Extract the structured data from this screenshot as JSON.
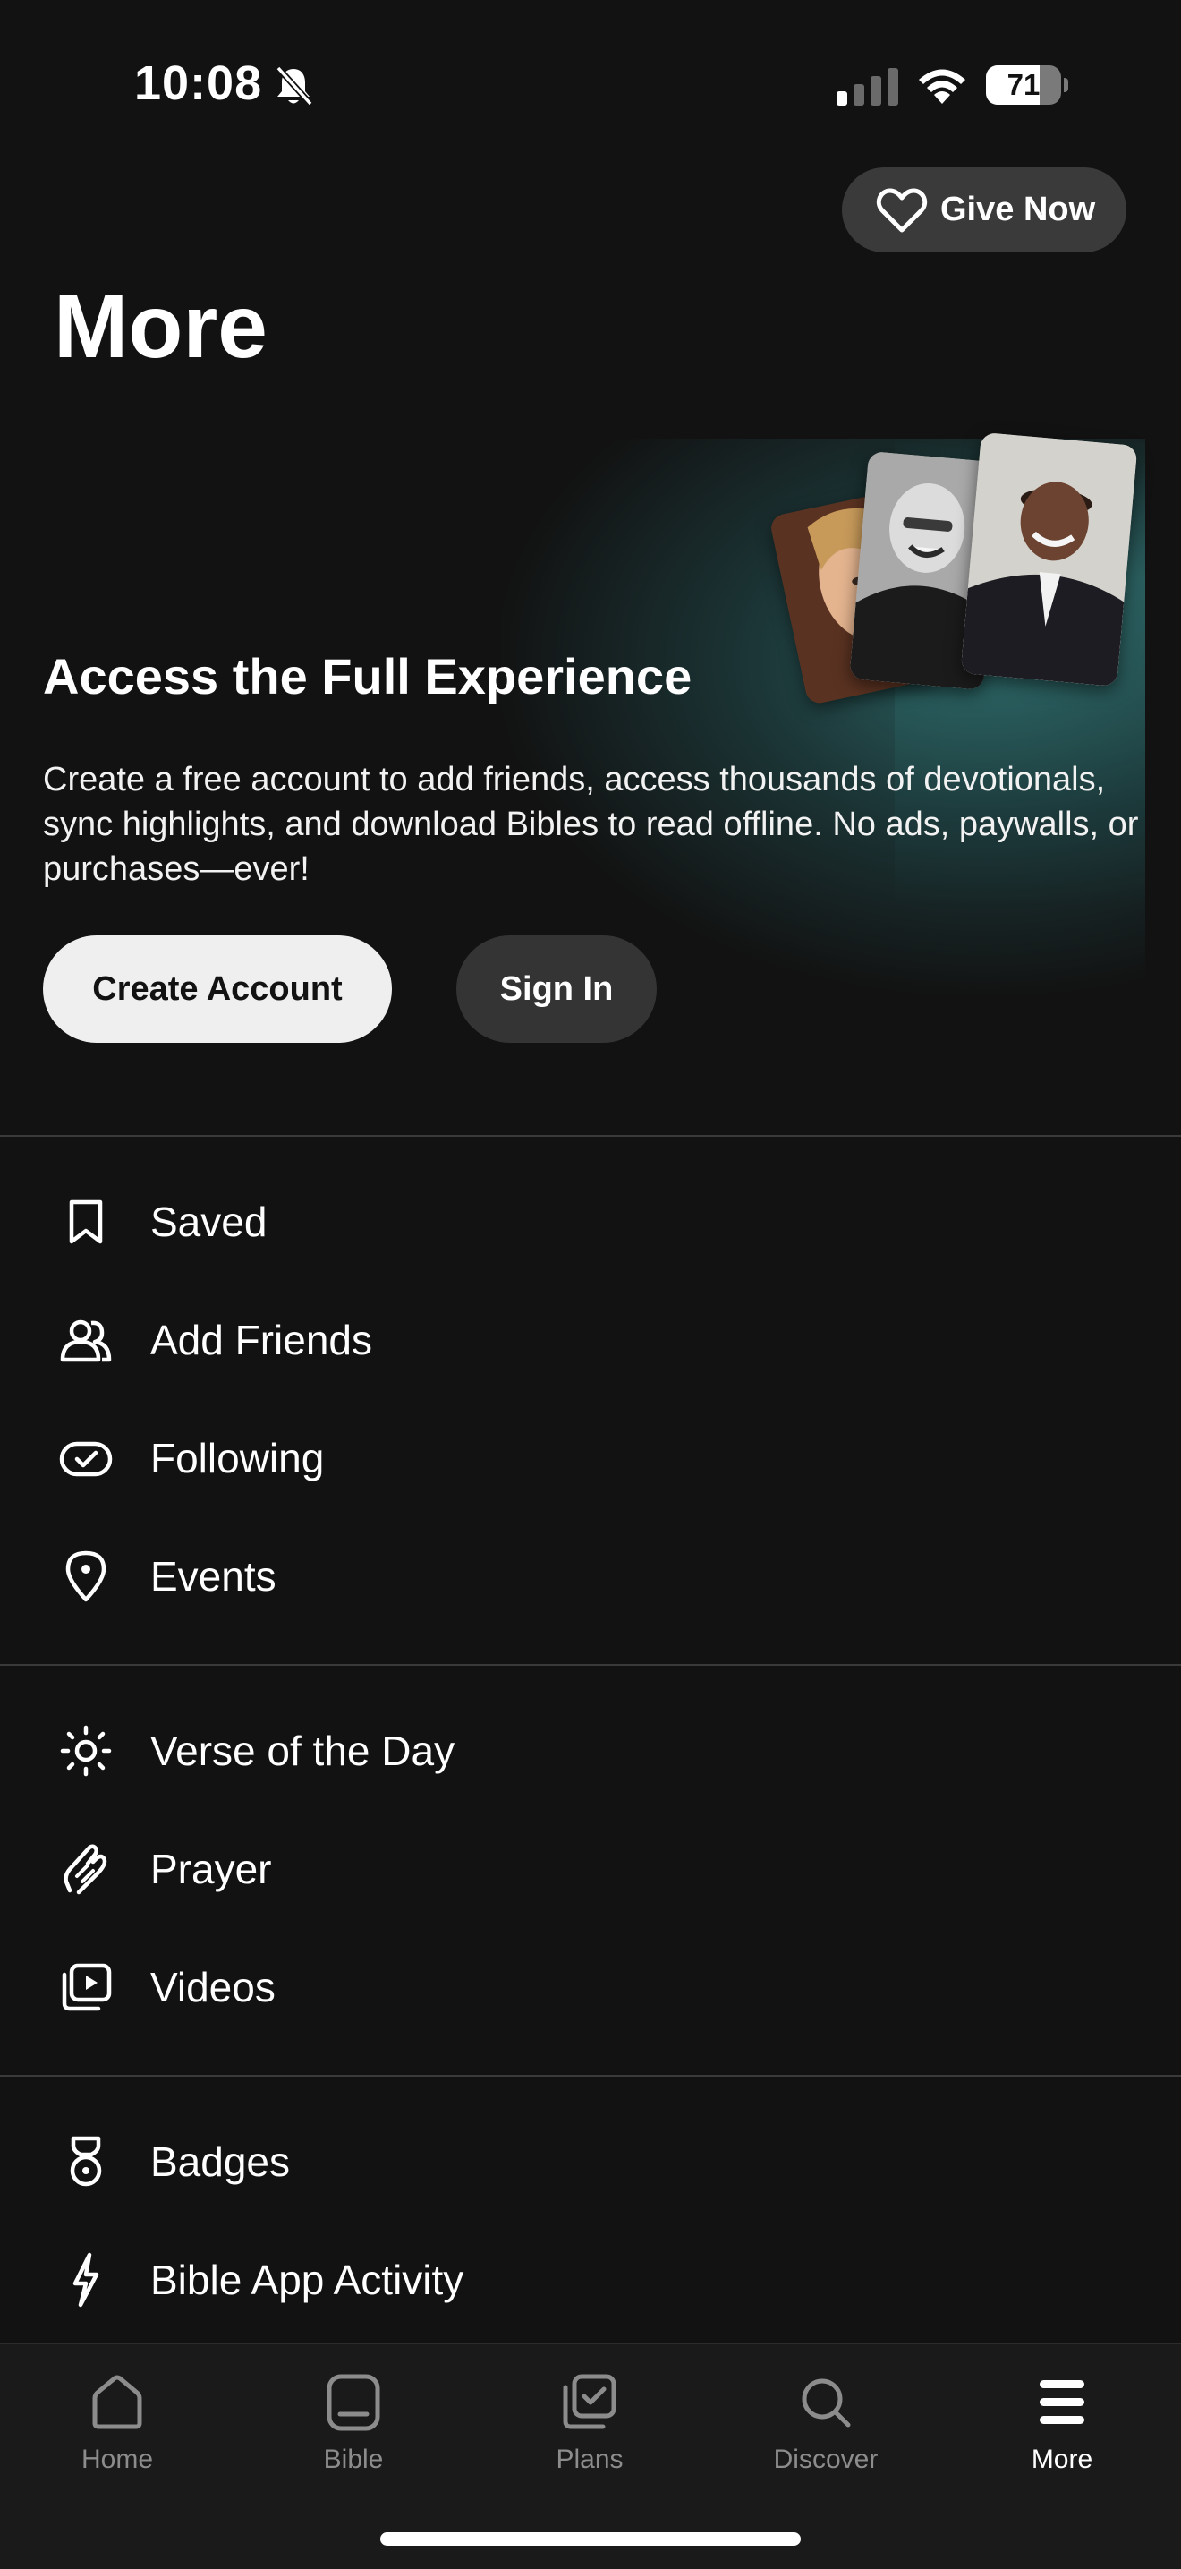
{
  "status_bar": {
    "time": "10:08",
    "battery": "71",
    "battery_level": 0.71
  },
  "header": {
    "give_label": "Give Now",
    "title": "More"
  },
  "hero": {
    "title": "Access the Full Experience",
    "description": "Create a free account to add friends, access thousands of devotionals, sync highlights, and download Bibles to read offline. No ads, paywalls, or purchases—ever!",
    "create_account_label": "Create Account",
    "sign_in_label": "Sign In"
  },
  "menu": {
    "section1": [
      {
        "label": "Saved",
        "icon": "bookmark-icon"
      },
      {
        "label": "Add Friends",
        "icon": "friends-icon"
      },
      {
        "label": "Following",
        "icon": "following-icon"
      },
      {
        "label": "Events",
        "icon": "location-pin-icon"
      }
    ],
    "section2": [
      {
        "label": "Verse of the Day",
        "icon": "sun-icon"
      },
      {
        "label": "Prayer",
        "icon": "praying-hands-icon"
      },
      {
        "label": "Videos",
        "icon": "videos-icon"
      }
    ],
    "section3": [
      {
        "label": "Badges",
        "icon": "badge-icon"
      },
      {
        "label": "Bible App Activity",
        "icon": "lightning-icon"
      }
    ]
  },
  "tab_bar": {
    "tabs": [
      {
        "label": "Home",
        "icon": "home-icon"
      },
      {
        "label": "Bible",
        "icon": "bible-icon"
      },
      {
        "label": "Plans",
        "icon": "plans-icon"
      },
      {
        "label": "Discover",
        "icon": "search-icon"
      },
      {
        "label": "More",
        "icon": "menu-icon"
      }
    ],
    "active": "More"
  },
  "colors": {
    "background": "#121212",
    "accent_glow": "#306e6e",
    "primary_button": "#efefef",
    "secondary_button": "#343434",
    "inactive_tab": "#8c8c8c"
  }
}
